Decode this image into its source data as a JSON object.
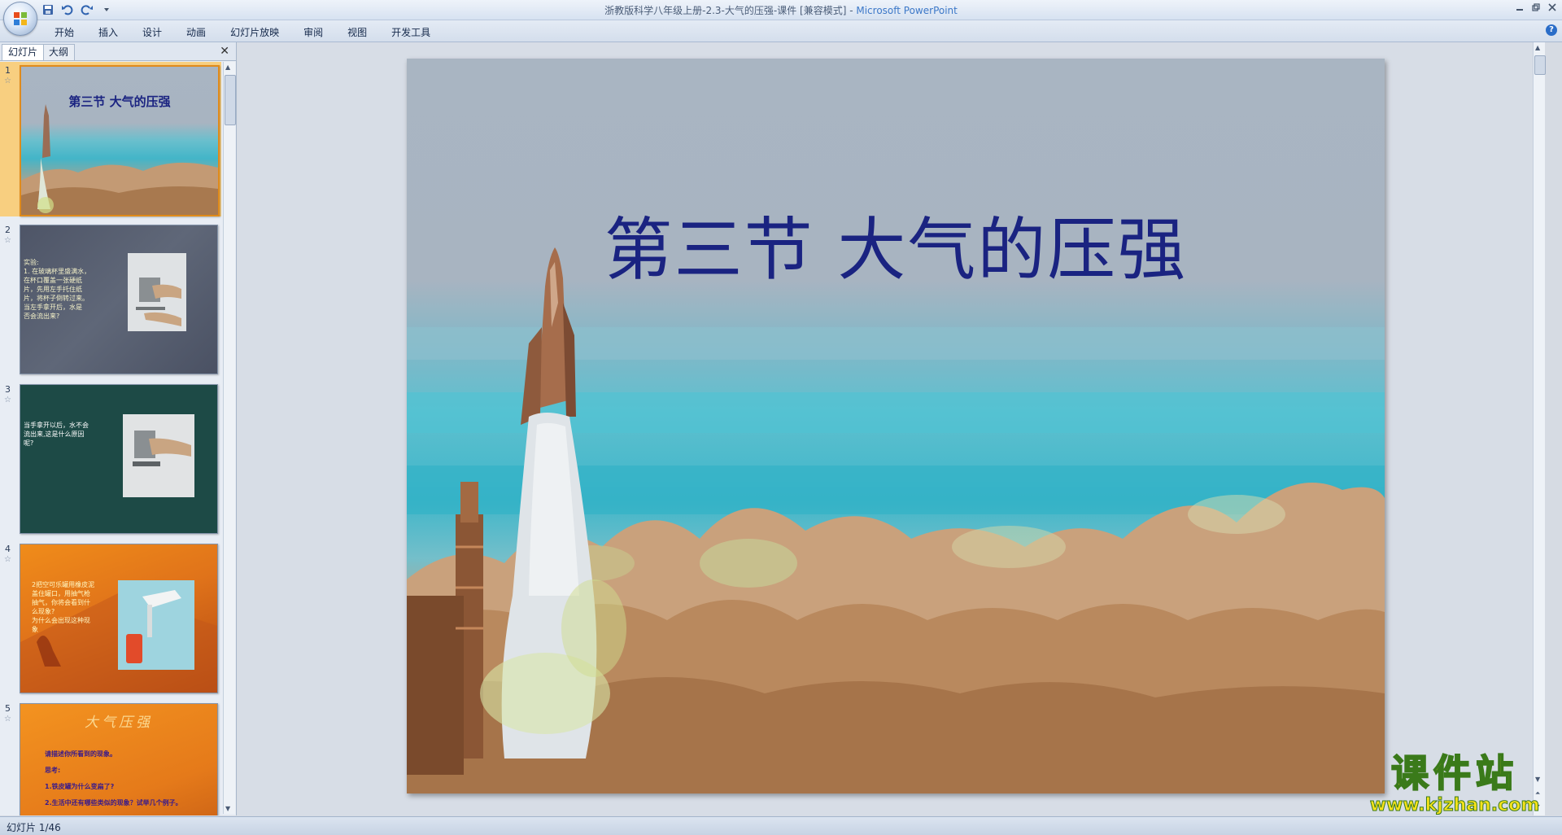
{
  "window": {
    "title": "浙教版科学八年级上册-2.3-大气的压强-课件 [兼容模式]",
    "separator": " - ",
    "app_name": "Microsoft PowerPoint"
  },
  "qat": {
    "icons": [
      "save-icon",
      "undo-icon",
      "redo-icon",
      "customize-dropdown-icon"
    ]
  },
  "ribbon": {
    "tabs": [
      "开始",
      "插入",
      "设计",
      "动画",
      "幻灯片放映",
      "审阅",
      "视图",
      "开发工具"
    ],
    "help_glyph": "?"
  },
  "left_panel": {
    "tabs": [
      "幻灯片",
      "大纲"
    ],
    "close_glyph": "✕",
    "slides": [
      {
        "number": "1",
        "title": "第三节  大气的压强",
        "selected": true
      },
      {
        "number": "2",
        "lines": [
          "实验:",
          "1. 在玻璃杯里盛满水，",
          "在杯口覆盖一张硬纸",
          "片，先用左手托住纸",
          "片，将杯子倒转过来。",
          "当左手拿开后，水是",
          "否会流出来?"
        ]
      },
      {
        "number": "3",
        "lines": [
          "当手拿开以后，水不会",
          "流出来,这是什么原因",
          "呢?"
        ]
      },
      {
        "number": "4",
        "lines": [
          "2把空可乐罐用橡皮泥",
          "盖住罐口，用抽气枪",
          "抽气，你将会看到什",
          "么现象?",
          "为什么会出现这种现",
          "象"
        ]
      },
      {
        "number": "5",
        "title": "大气压强",
        "lines": [
          "请描述你所看到的现象。",
          "思考:",
          "1.铁皮罐为什么变扁了?",
          "2.生活中还有哪些类似的现象？试举几个例子。"
        ]
      }
    ]
  },
  "slide": {
    "title": "第三节   大气的压强"
  },
  "status": {
    "text": "幻灯片 1/46"
  },
  "watermark": {
    "line1": "课件站",
    "line2": "www.kjzhan.com"
  },
  "colors": {
    "title_blue": "#1a2381",
    "selection_orange": "#e08b1b",
    "app_name_blue": "#3c78c8"
  }
}
